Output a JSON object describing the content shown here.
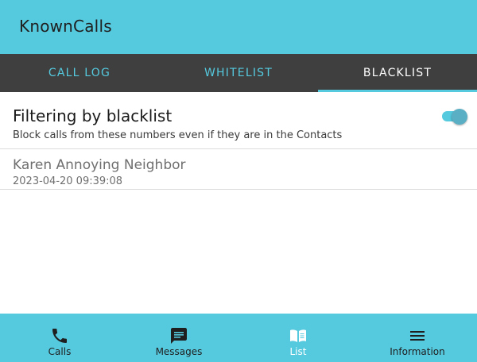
{
  "app": {
    "title": "KnownCalls"
  },
  "tabs": [
    {
      "label": "CALL LOG",
      "selected": false
    },
    {
      "label": "WHITELIST",
      "selected": false
    },
    {
      "label": "BLACKLIST",
      "selected": true
    }
  ],
  "filter": {
    "title": "Filtering by blacklist",
    "subtitle": "Block calls from these numbers even if they are in the Contacts",
    "enabled": true
  },
  "blacklist": [
    {
      "name": "Karen Annoying Neighbor",
      "timestamp": "2023-04-20 09:39:08"
    }
  ],
  "bottom_nav": [
    {
      "label": "Calls",
      "icon": "phone-icon",
      "active": false
    },
    {
      "label": "Messages",
      "icon": "message-icon",
      "active": false
    },
    {
      "label": "List",
      "icon": "book-icon",
      "active": true
    },
    {
      "label": "Information",
      "icon": "menu-icon",
      "active": false
    }
  ],
  "colors": {
    "accent": "#55c9de",
    "tab_bar": "#3f3f3f",
    "switch_thumb": "#5aafc4"
  }
}
